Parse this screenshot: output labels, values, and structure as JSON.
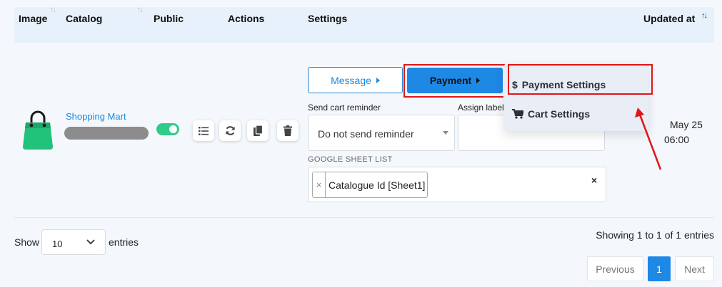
{
  "table": {
    "headers": [
      "Image",
      "Catalog",
      "Public",
      "Actions",
      "Settings",
      "Updated at"
    ],
    "row": {
      "catalog_name": "Shopping Mart",
      "public_on": true,
      "actions": [
        "list-icon",
        "refresh-icon",
        "copy-icon",
        "trash-icon"
      ],
      "updated_date": "May 25",
      "updated_time": "06:00"
    }
  },
  "settings": {
    "message_label": "Message",
    "payment_label": "Payment",
    "send_cart_reminder_label": "Send cart reminder",
    "send_cart_reminder_value": "Do not send reminder",
    "assign_label": "Assign label",
    "google_sheet_label": "GOOGLE SHEET LIST",
    "sheet_tag": "Catalogue Id [Sheet1]",
    "tag_remove": "×",
    "clear": "×"
  },
  "dropdown": {
    "items": [
      {
        "icon": "dollar-icon",
        "label": "Payment Settings"
      },
      {
        "icon": "cart-icon",
        "label": "Cart Settings"
      }
    ]
  },
  "footer": {
    "show_label": "Show",
    "page_length": "10",
    "entries_label": "entries",
    "info": "Showing 1 to 1 of 1 entries",
    "previous": "Previous",
    "current_page": "1",
    "next": "Next"
  },
  "colors": {
    "accent": "#1e88e5",
    "highlight": "#e01616",
    "toggle_on": "#2ecc8a",
    "bag_green": "#21c27a"
  }
}
